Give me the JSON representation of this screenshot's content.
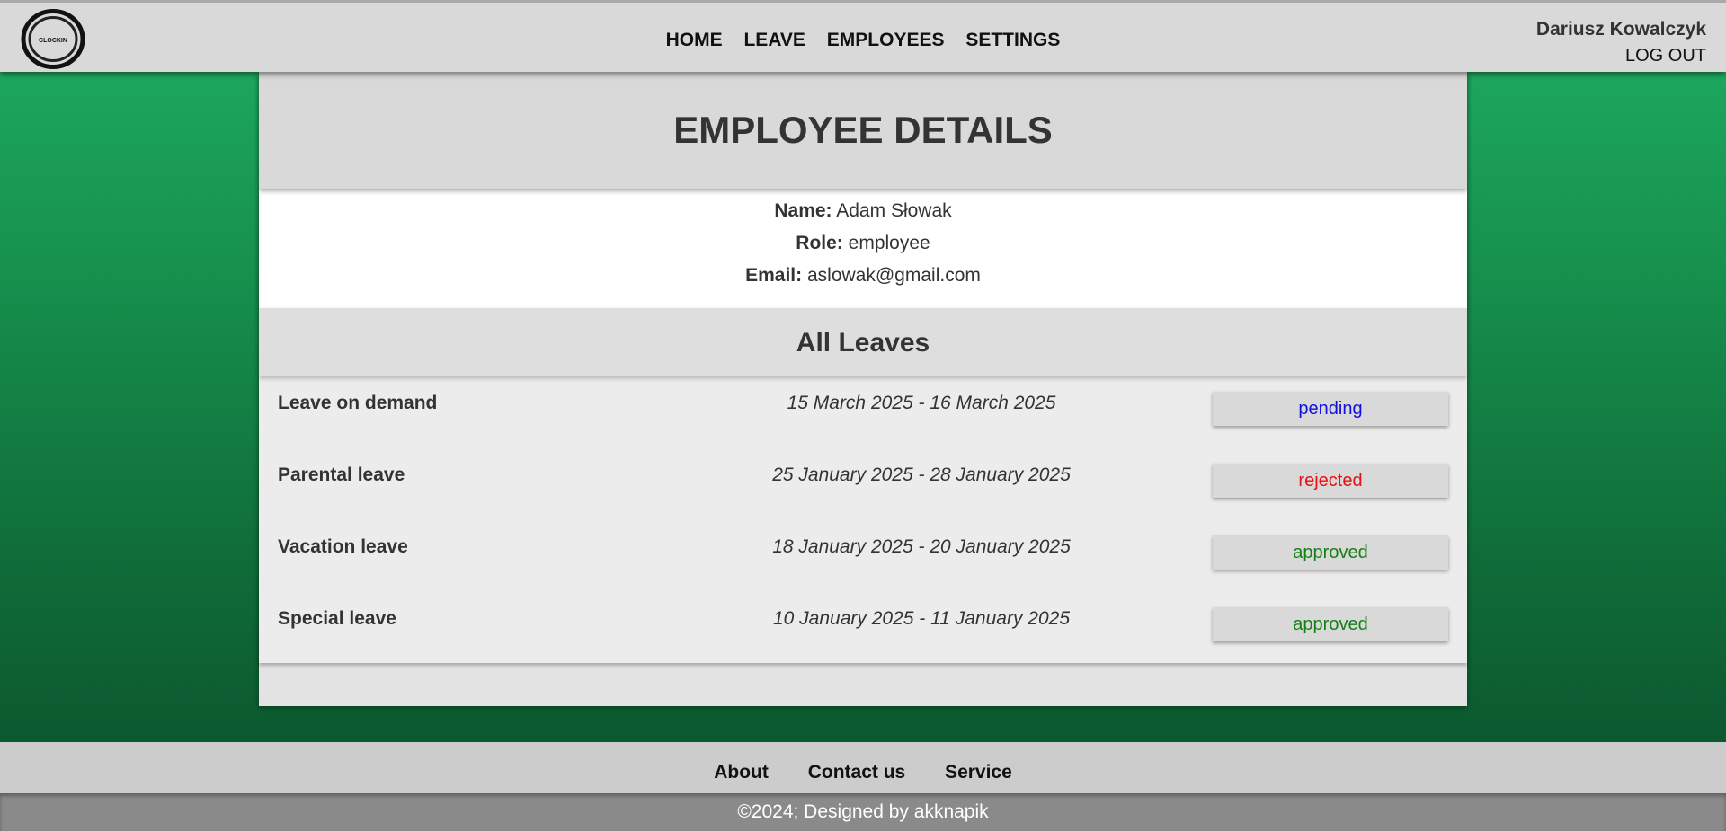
{
  "header": {
    "logo_text": "CLOCKIN",
    "nav": [
      "HOME",
      "LEAVE",
      "EMPLOYEES",
      "SETTINGS"
    ],
    "user_name": "Dariusz Kowalczyk",
    "logout_label": "LOG OUT"
  },
  "page": {
    "title": "EMPLOYEE DETAILS"
  },
  "employee": {
    "name_label": "Name:",
    "name": "Adam Słowak",
    "role_label": "Role:",
    "role": "employee",
    "email_label": "Email:",
    "email": "aslowak@gmail.com"
  },
  "leaves": {
    "heading": "All Leaves",
    "items": [
      {
        "type": "Leave on demand",
        "dates": "15 March 2025 - 16 March 2025",
        "status": "pending"
      },
      {
        "type": "Parental leave",
        "dates": "25 January 2025 - 28 January 2025",
        "status": "rejected"
      },
      {
        "type": "Vacation leave",
        "dates": "18 January 2025 - 20 January 2025",
        "status": "approved"
      },
      {
        "type": "Special leave",
        "dates": "10 January 2025 - 11 January 2025",
        "status": "approved"
      }
    ]
  },
  "status_colors": {
    "pending": "#1010e0",
    "rejected": "#e81010",
    "approved": "#168016"
  },
  "footer": {
    "links": [
      "About",
      "Contact us",
      "Service"
    ],
    "copyright": "©2024; Designed by akknapik"
  }
}
